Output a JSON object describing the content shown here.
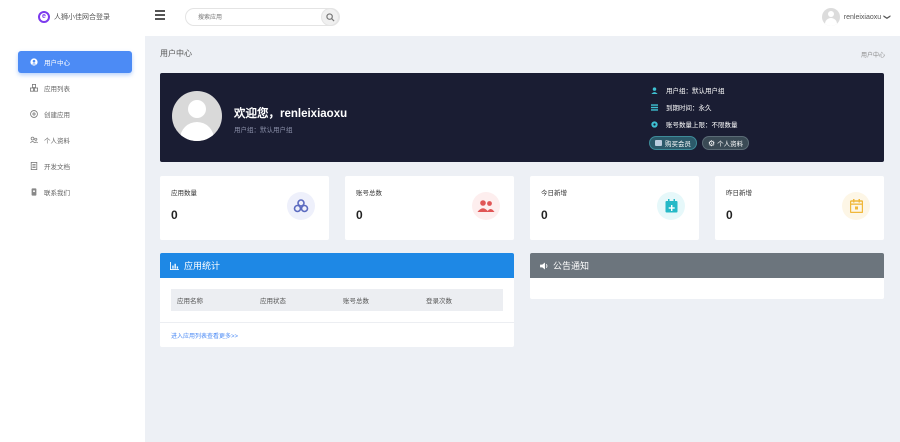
{
  "colors": {
    "accent": "#4c8bf5",
    "banner_bg": "#1a1d33",
    "panel_blue": "#1e88e5",
    "panel_gray": "#6c757d",
    "brand": "#7c3aed"
  },
  "header": {
    "brand_title": "人狮小佳网合登录",
    "search_placeholder": "搜索应用",
    "username": "renleixiaoxu",
    "caret": "❯"
  },
  "sidebar": {
    "items": [
      {
        "label": "用户中心",
        "icon": "user-circle-icon",
        "active": true
      },
      {
        "label": "应用列表",
        "icon": "cubes-icon",
        "active": false
      },
      {
        "label": "创建应用",
        "icon": "plus-circle-icon",
        "active": false
      },
      {
        "label": "个人资料",
        "icon": "users-icon",
        "active": false
      },
      {
        "label": "开发文档",
        "icon": "document-icon",
        "active": false
      },
      {
        "label": "联系我们",
        "icon": "contact-icon",
        "active": false
      }
    ]
  },
  "page": {
    "title": "用户中心",
    "breadcrumb": "用户中心"
  },
  "banner": {
    "welcome": "欢迎您，renleixiaoxu",
    "group": "用户组：默认用户组",
    "info": [
      {
        "text": "用户组：默认用户组",
        "icon": "user-icon"
      },
      {
        "text": "到期时间：永久",
        "icon": "list-icon"
      },
      {
        "text": "账号数量上限：不限数量",
        "icon": "circle-icon"
      }
    ],
    "buy_label": "购买会员",
    "profile_label": "个人资料"
  },
  "stats": [
    {
      "label": "应用数量",
      "value": "0",
      "icon": "cubes-icon",
      "color": "#5c6bc0",
      "bg": "#eef0fb"
    },
    {
      "label": "账号总数",
      "value": "0",
      "icon": "users-icon",
      "color": "#e05555",
      "bg": "#fdeeee"
    },
    {
      "label": "今日新增",
      "value": "0",
      "icon": "calendar-plus-icon",
      "color": "#26b9c7",
      "bg": "#e6f8fa"
    },
    {
      "label": "昨日新增",
      "value": "0",
      "icon": "calendar-check-icon",
      "color": "#f0b73a",
      "bg": "#fdf6e6"
    }
  ],
  "app_panel": {
    "title": "应用统计",
    "columns": [
      "应用名称",
      "应用状态",
      "账号总数",
      "登录次数"
    ],
    "link": "进入应用列表查看更多>>"
  },
  "notice_panel": {
    "title": "公告通知"
  }
}
